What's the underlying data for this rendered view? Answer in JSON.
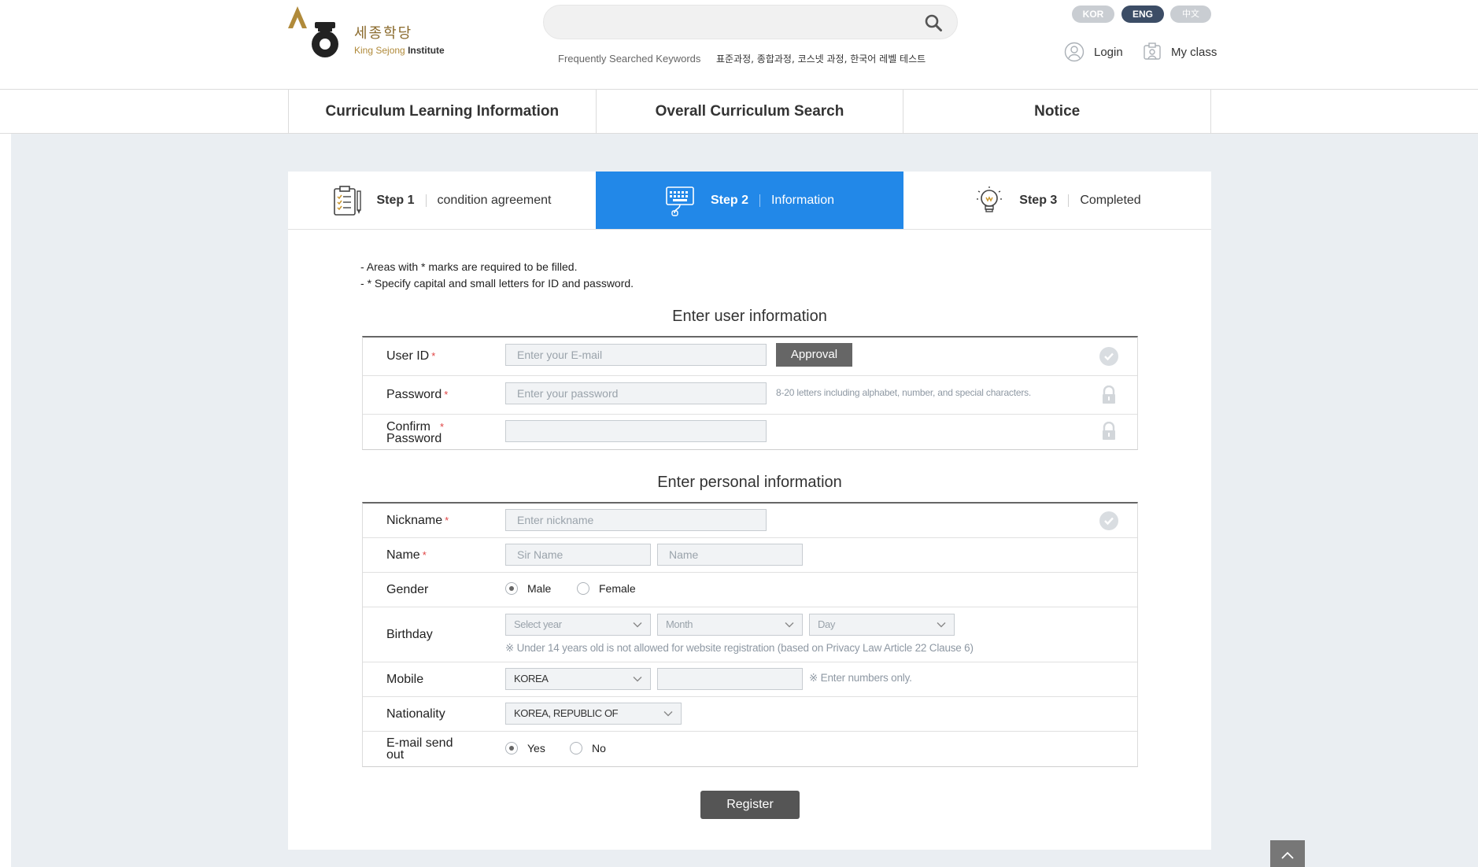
{
  "header": {
    "logo": {
      "korean": "세종학당",
      "brand": "King Sejong",
      "brand_suffix": "Institute"
    },
    "search": {
      "placeholder": ""
    },
    "keywords_label": "Frequently Searched Keywords",
    "keywords_values": "표준과정, 종합과정, 코스넷 과정, 한국어 레벨 테스트",
    "languages": [
      "KOR",
      "ENG",
      "中文"
    ],
    "login_label": "Login",
    "myclass_label": "My class"
  },
  "nav": {
    "items": [
      "Curriculum Learning Information",
      "Overall Curriculum Search",
      "Notice"
    ]
  },
  "steps": [
    {
      "num": "Step 1",
      "label": "condition agreement",
      "icon": "clipboard-icon",
      "active": false
    },
    {
      "num": "Step 2",
      "label": "Information",
      "icon": "keyboard-icon",
      "active": true
    },
    {
      "num": "Step 3",
      "label": "Completed",
      "icon": "lightbulb-icon",
      "active": false
    }
  ],
  "notes": [
    "Areas with * marks are required to be filled.",
    "* Specify capital and small letters for ID and password."
  ],
  "user_section": {
    "title": "Enter user information",
    "user_id": {
      "label": "User ID",
      "placeholder": "Enter your E-mail",
      "button": "Approval"
    },
    "password": {
      "label": "Password",
      "placeholder": "Enter your password",
      "hint": "8-20 letters including alphabet, number, and special characters."
    },
    "confirm_password": {
      "label_line1": "Confirm",
      "label_line2": "Password",
      "placeholder": ""
    }
  },
  "personal_section": {
    "title": "Enter personal information",
    "nickname": {
      "label": "Nickname",
      "placeholder": "Enter nickname"
    },
    "name": {
      "label": "Name",
      "surname_placeholder": "Sir Name",
      "name_placeholder": "Name"
    },
    "gender": {
      "label": "Gender",
      "options": [
        "Male",
        "Female"
      ],
      "selected": "Male"
    },
    "birthday": {
      "label": "Birthday",
      "year": "Select year",
      "month": "Month",
      "day": "Day",
      "hint": "※ Under 14 years old is not allowed for website registration (based on Privacy Law Article 22 Clause 6)"
    },
    "mobile": {
      "label": "Mobile",
      "country": "KOREA",
      "number_placeholder": "",
      "hint": "※ Enter numbers only."
    },
    "nationality": {
      "label": "Nationality",
      "value": "KOREA, REPUBLIC OF"
    },
    "email_send": {
      "label_line1": "E-mail send",
      "label_line2": "out",
      "options": [
        "Yes",
        "No"
      ],
      "selected": "Yes"
    }
  },
  "register_label": "Register",
  "colors": {
    "accent": "#2288e8",
    "nav_dark": "#3c4d66",
    "gold": "#b08a3a"
  }
}
